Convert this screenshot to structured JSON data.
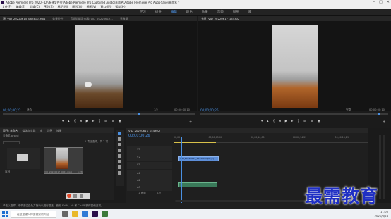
{
  "window": {
    "title": "Adobe Premiere Pro 2020 - D:\\新建文件夹\\Adobe Premiere Pro Captured Audio\\未命名\\Adobe Premiere Pro Auto-Save\\未命名 *"
  },
  "menu": [
    "文件(F)",
    "编辑(E)",
    "剪辑(C)",
    "序列(S)",
    "标记(M)",
    "图形(G)",
    "视图(V)",
    "窗口(W)",
    "帮助(H)"
  ],
  "workspaces": {
    "items": [
      "学习",
      "组件",
      "编辑",
      "颜色",
      "效果",
      "音频",
      "图形",
      "库"
    ],
    "active": "编辑"
  },
  "source_panel": {
    "tabs": [
      "源: VID_20220615_082410.mp4",
      "效果控件",
      "音频剪辑混合器: VID_20220617...",
      "元数据"
    ],
    "timecode_in": "00;00;00;22",
    "fit_label": "适合",
    "duration": "00;00;00;10",
    "fraction": "1/2"
  },
  "program_panel": {
    "tab": "节目: VID_20220617_154302",
    "timecode_in": "00;00;00;26",
    "fit_label": "完整",
    "duration": "00;00;00;10"
  },
  "project_panel": {
    "tabs": [
      "项目: 未命名",
      "媒体浏览器",
      "库",
      "信息",
      "效果"
    ],
    "project_file": "未命名.prproj",
    "item_count": "1 项已选择，共 2 项",
    "clip_name": "VID_20220617_0023.mp4",
    "clip_duration": "1;28",
    "bin_label": "序列"
  },
  "timeline": {
    "tab": "VID_20220617_154302",
    "timecode": "00;00;00;26",
    "ruler": [
      "00;00",
      "00;00;05;00",
      "00;00;10;00",
      "00;00;14;29",
      "00;00;19;29"
    ],
    "tracks_video": [
      "V3",
      "V2",
      "V1"
    ],
    "tracks_audio": [
      "A1",
      "A2",
      "A3"
    ],
    "master": "主声道",
    "master_value": "0.0",
    "clip_video_label": "VID_20220617_154302.mp4 [V]"
  },
  "status_bar": "单击以选择，或单击空白处并拖动以进行框选。使用 Shift、Alt 和 Ctrl 可获得其他选项。",
  "taskbar": {
    "search_placeholder": "在这里输入你要搜索的内容",
    "time": "11:00",
    "date": "2021/6/24"
  },
  "watermark": "最需教育",
  "colors": {
    "accent": "#4a90e2",
    "clip_video": "#5d8ed8",
    "clip_audio": "#3a7a5a",
    "watermark": "#1f2fc4"
  }
}
